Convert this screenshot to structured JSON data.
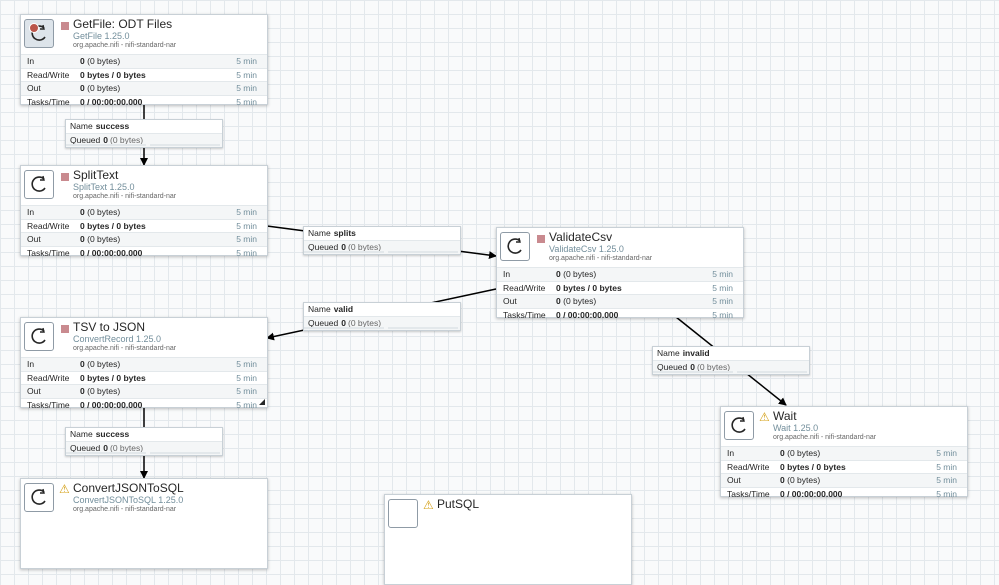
{
  "processors": [
    {
      "name": "GetFile: ODT Files",
      "type": "GetFile 1.25.0",
      "bundle": "org.apache.nifi - nifi-standard-nar",
      "status": "stopped",
      "in": "0 (0 bytes)",
      "in_count": "0",
      "in_size": "(0 bytes)",
      "rw": "0 bytes / 0 bytes",
      "out_count": "0",
      "out_size": "(0 bytes)",
      "tasks": "0 / 00:00:00.000",
      "time": "5 min"
    },
    {
      "name": "SplitText",
      "type": "SplitText 1.25.0",
      "bundle": "org.apache.nifi - nifi-standard-nar",
      "status": "stopped",
      "in_count": "0",
      "in_size": "(0 bytes)",
      "rw": "0 bytes / 0 bytes",
      "out_count": "0",
      "out_size": "(0 bytes)",
      "tasks": "0 / 00:00:00.000",
      "time": "5 min"
    },
    {
      "name": "ValidateCsv",
      "type": "ValidateCsv 1.25.0",
      "bundle": "org.apache.nifi - nifi-standard-nar",
      "status": "stopped",
      "in_count": "0",
      "in_size": "(0 bytes)",
      "rw": "0 bytes / 0 bytes",
      "out_count": "0",
      "out_size": "(0 bytes)",
      "tasks": "0 / 00:00:00.000",
      "time": "5 min"
    },
    {
      "name": "TSV to JSON",
      "type": "ConvertRecord 1.25.0",
      "bundle": "org.apache.nifi - nifi-standard-nar",
      "status": "stopped",
      "in_count": "0",
      "in_size": "(0 bytes)",
      "rw": "0 bytes / 0 bytes",
      "out_count": "0",
      "out_size": "(0 bytes)",
      "tasks": "0 / 00:00:00.000",
      "time": "5 min"
    },
    {
      "name": "Wait",
      "type": "Wait 1.25.0",
      "bundle": "org.apache.nifi - nifi-standard-nar",
      "status": "invalid",
      "in_count": "0",
      "in_size": "(0 bytes)",
      "rw": "0 bytes / 0 bytes",
      "out_count": "0",
      "out_size": "(0 bytes)",
      "tasks": "0 / 00:00:00.000",
      "time": "5 min"
    },
    {
      "name": "ConvertJSONToSQL",
      "type": "ConvertJSONToSQL 1.25.0",
      "bundle": "org.apache.nifi - nifi-standard-nar",
      "status": "invalid"
    },
    {
      "name": "PutSQL"
    }
  ],
  "row_labels": {
    "in": "In",
    "rw": "Read/Write",
    "out": "Out",
    "tasks": "Tasks/Time"
  },
  "connections": [
    {
      "name_label": "Name",
      "name": "success",
      "queued_label": "Queued",
      "count": "0",
      "size": "(0 bytes)"
    },
    {
      "name_label": "Name",
      "name": "splits",
      "queued_label": "Queued",
      "count": "0",
      "size": "(0 bytes)"
    },
    {
      "name_label": "Name",
      "name": "valid",
      "queued_label": "Queued",
      "count": "0",
      "size": "(0 bytes)"
    },
    {
      "name_label": "Name",
      "name": "invalid",
      "queued_label": "Queued",
      "count": "0",
      "size": "(0 bytes)"
    },
    {
      "name_label": "Name",
      "name": "success",
      "queued_label": "Queued",
      "count": "0",
      "size": "(0 bytes)"
    }
  ],
  "colors": {
    "stopped": "#c98a8f",
    "warning": "#d4a017",
    "accent": "#728e9b"
  }
}
